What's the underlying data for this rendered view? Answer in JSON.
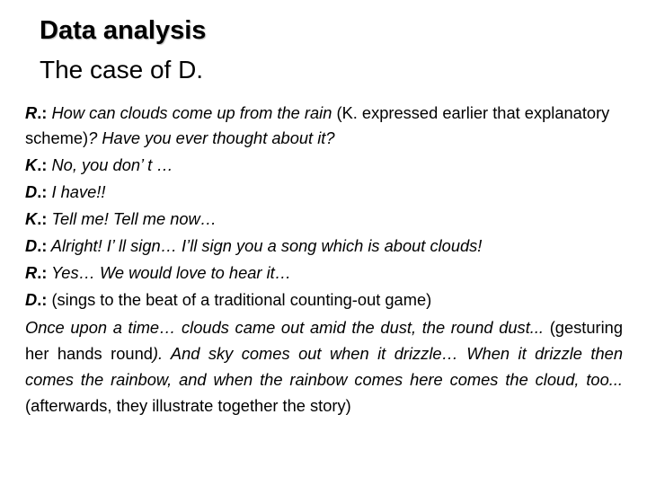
{
  "slide": {
    "title": "Data analysis",
    "subtitle": "The case of D."
  },
  "transcript": [
    {
      "speaker": "R.",
      "parts": [
        {
          "style": "italic",
          "text": " How can clouds come up from the rain"
        },
        {
          "style": "normal",
          "text": " (K. expressed earlier that explanatory scheme)"
        },
        {
          "style": "italic",
          "text": "? Have you ever thought about it?"
        }
      ]
    },
    {
      "speaker": "K.",
      "parts": [
        {
          "style": "italic",
          "text": " No, you don’ t …"
        }
      ]
    },
    {
      "speaker": "D.",
      "parts": [
        {
          "style": "italic",
          "text": " I have!!"
        }
      ]
    },
    {
      "speaker": "K.",
      "parts": [
        {
          "style": "italic",
          "text": " Tell me! Tell me now…"
        }
      ]
    },
    {
      "speaker": "D.",
      "parts": [
        {
          "style": "italic",
          "text": " Alright! I’ ll sign… I’ll sign you a song which is about clouds!"
        }
      ]
    },
    {
      "speaker": "R.",
      "parts": [
        {
          "style": "italic",
          "text": " Yes… We would love to hear it…"
        }
      ]
    },
    {
      "speaker": "D.",
      "parts": [
        {
          "style": "normal",
          "text": " (sings to the beat of a traditional counting-out game)"
        }
      ]
    }
  ],
  "story": [
    {
      "style": "italic",
      "text": "Once upon a time… clouds came out amid the dust, the round dust... "
    },
    {
      "style": "normal",
      "text": "(gesturing her hands round"
    },
    {
      "style": "italic",
      "text": "). And sky comes out when it drizzle… When it drizzle then comes the rainbow, and when the rainbow comes here comes the cloud, too... "
    },
    {
      "style": "normal",
      "text": "(afterwards, they illustrate together the story)"
    }
  ]
}
